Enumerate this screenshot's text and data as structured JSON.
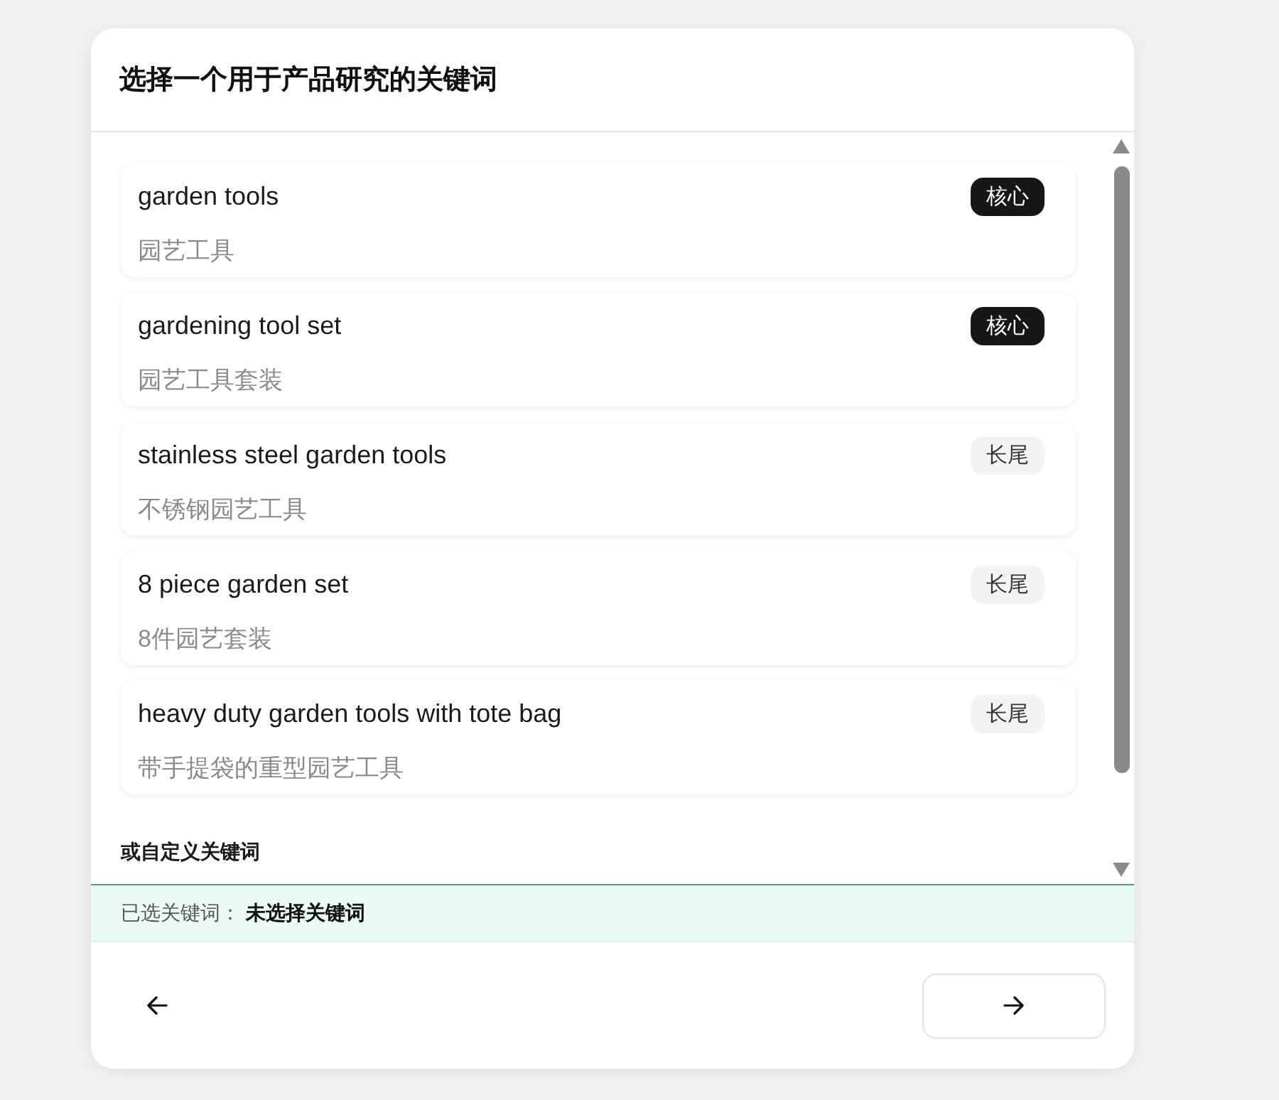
{
  "dialog": {
    "title": "选择一个用于产品研究的关键词"
  },
  "keywords": [
    {
      "term": "garden tools",
      "translation": "园艺工具",
      "tag": {
        "label": "核心",
        "kind": "core"
      },
      "selected": false
    },
    {
      "term": "gardening tool set",
      "translation": "园艺工具套装",
      "tag": {
        "label": "核心",
        "kind": "core"
      },
      "selected": false
    },
    {
      "term": "stainless steel garden tools",
      "translation": "不锈钢园艺工具",
      "tag": {
        "label": "长尾",
        "kind": "long_tail"
      },
      "selected": false
    },
    {
      "term": "8 piece garden set",
      "translation": "8件园艺套装",
      "tag": {
        "label": "长尾",
        "kind": "long_tail"
      },
      "selected": false
    },
    {
      "term": "heavy duty garden tools with tote bag",
      "translation": "带手提袋的重型园艺工具",
      "tag": {
        "label": "长尾",
        "kind": "long_tail"
      },
      "selected": false
    }
  ],
  "custom_section": {
    "label": "或自定义关键词"
  },
  "selection_bar": {
    "label": "已选关键词：",
    "value": "未选择关键词"
  }
}
